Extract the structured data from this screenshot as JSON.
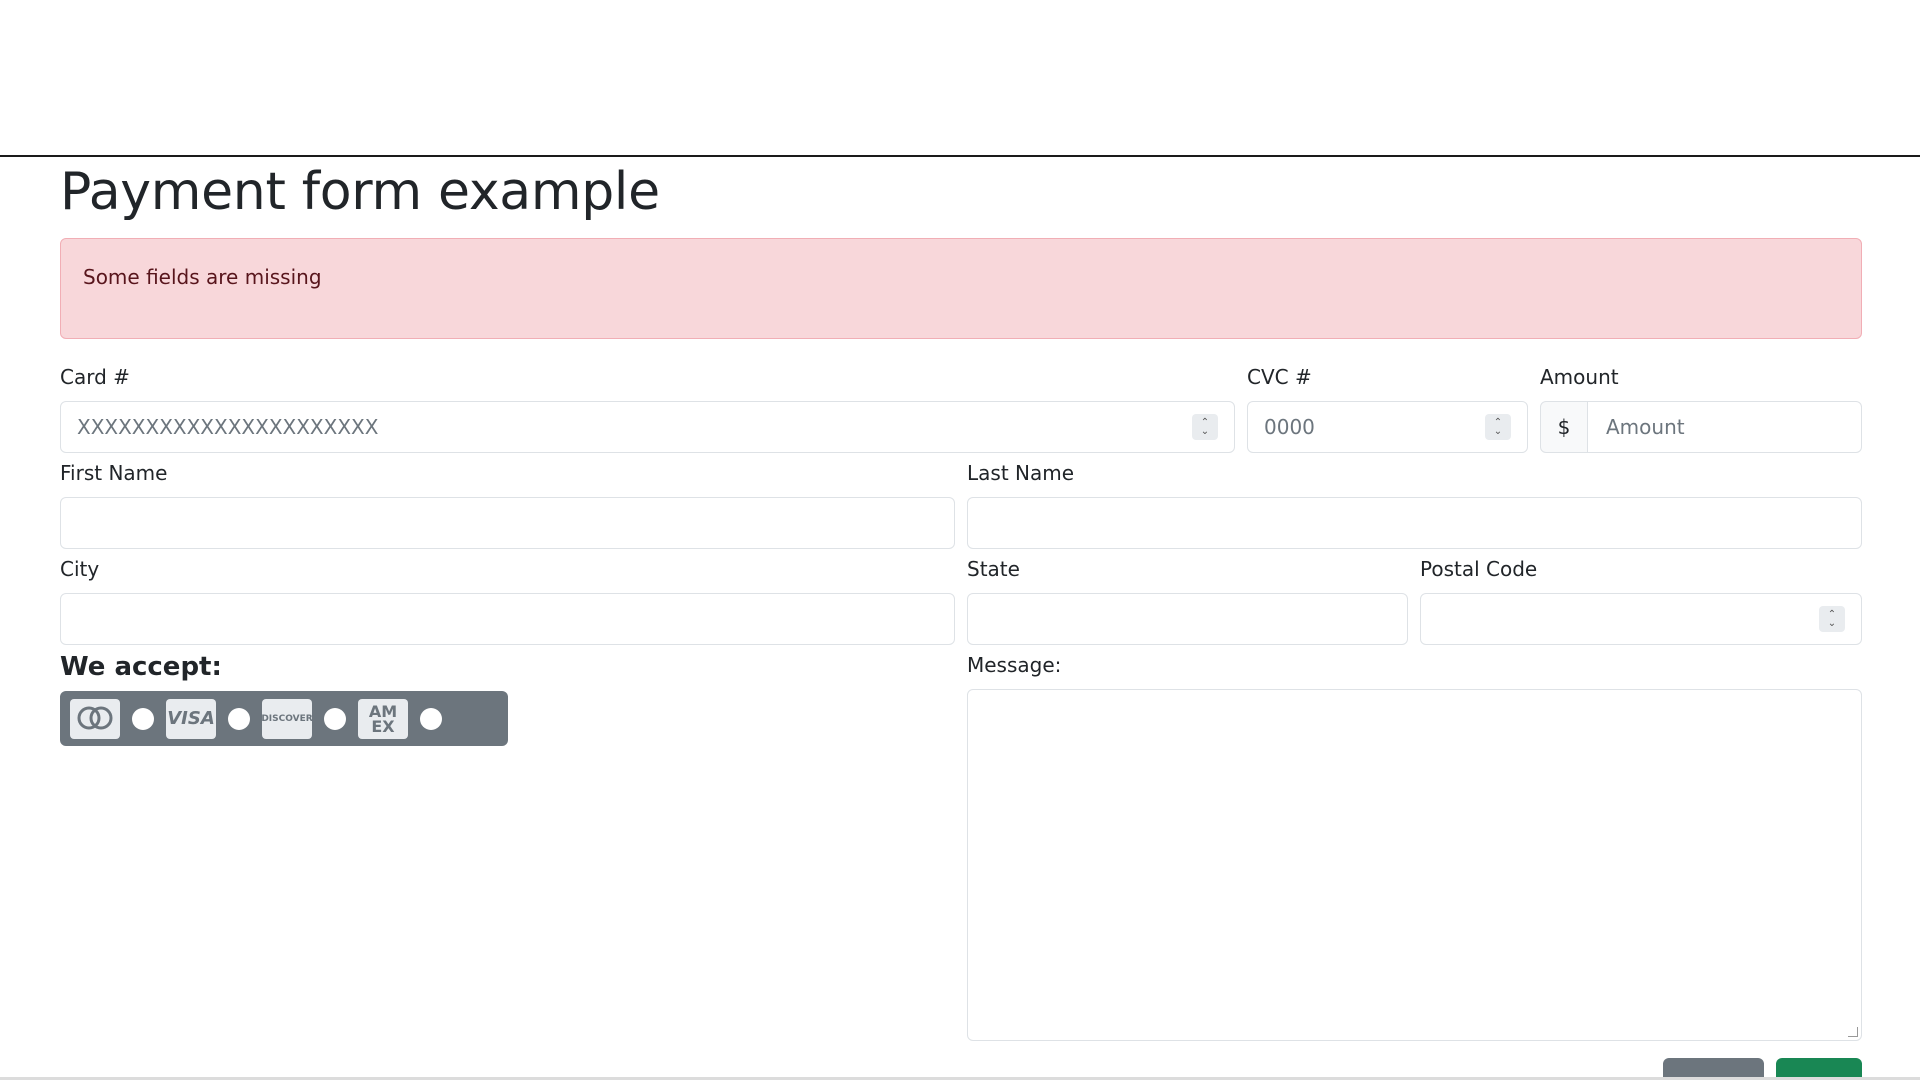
{
  "page": {
    "title": "Payment form example"
  },
  "alert": {
    "text": "Some fields are missing"
  },
  "fields": {
    "card": {
      "label": "Card #",
      "placeholder": "XXXXXXXXXXXXXXXXXXXXXX"
    },
    "cvc": {
      "label": "CVC #",
      "placeholder": "0000"
    },
    "amount": {
      "label": "Amount",
      "prefix": "$",
      "placeholder": "Amount"
    },
    "first_name": {
      "label": "First Name"
    },
    "last_name": {
      "label": "Last Name"
    },
    "city": {
      "label": "City"
    },
    "state": {
      "label": "State"
    },
    "postal_code": {
      "label": "Postal Code"
    },
    "message": {
      "label": "Message:"
    }
  },
  "accept": {
    "title": "We accept:",
    "cards": [
      {
        "name": "mastercard",
        "icon": "mastercard-icon"
      },
      {
        "name": "visa",
        "icon": "visa-icon",
        "text": "VISA"
      },
      {
        "name": "discover",
        "icon": "discover-icon",
        "text": "DISCOVER"
      },
      {
        "name": "amex",
        "icon": "amex-icon",
        "text": "AM EX"
      }
    ]
  },
  "buttons": {
    "cancel": {
      "color": "#6c757d"
    },
    "send": {
      "color": "#198754"
    }
  },
  "colors": {
    "alert_bg": "#f8d7da",
    "alert_text": "#58151c",
    "card_bar": "#6c757d"
  }
}
